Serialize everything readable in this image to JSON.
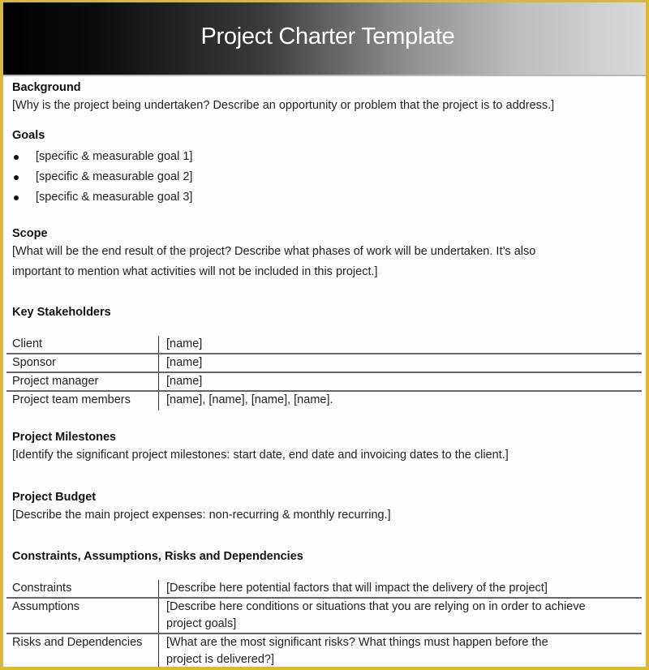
{
  "document": {
    "title": "Project Charter Template",
    "accent_border_color": "#d9b93a",
    "sections": {
      "background": {
        "heading": "Background",
        "text": "[Why is the project being undertaken?  Describe an opportunity  or problem that the project is to address.]"
      },
      "goals": {
        "heading": "Goals",
        "items": [
          "[specific & measurable goal  1]",
          "[specific & measurable goal  2]",
          "[specific & measurable goal  3]"
        ]
      },
      "scope": {
        "heading": "Scope",
        "lines": [
          "[What will be the end result of the project? Describe what phases of work will be undertaken.  It’s also",
          "important to mention what activities will not be included  in this project.]"
        ]
      },
      "stakeholders": {
        "heading": "Key Stakeholders",
        "rows": [
          {
            "role": "Client",
            "value": "[name]"
          },
          {
            "role": "Sponsor",
            "value": "[name]"
          },
          {
            "role": "Project manager",
            "value": "[name]"
          },
          {
            "role": "Project team members",
            "value": "[name], [name], [name], [name]."
          }
        ]
      },
      "milestones": {
        "heading": "Project Milestones",
        "text": "[Identify the significant project milestones: start date, end date and invoicing dates to the client.]"
      },
      "budget": {
        "heading": "Project Budget",
        "text": "[Describe the main project expenses: non-recurring  & monthly recurring.]"
      },
      "constraints": {
        "heading": "Constraints, Assumptions, Risks and Dependencies",
        "rows": [
          {
            "label": "Constraints",
            "lines": [
              "[Describe here potential factors that will impact the delivery of the project]"
            ]
          },
          {
            "label": "Assumptions",
            "lines": [
              "[Describe here conditions or situations that you are relying on in order to achieve",
              "project goals]"
            ]
          },
          {
            "label": "Risks and Dependencies",
            "lines": [
              "[What are the most significant risks? What things must happen before the",
              "project is delivered?]"
            ]
          }
        ]
      }
    }
  }
}
